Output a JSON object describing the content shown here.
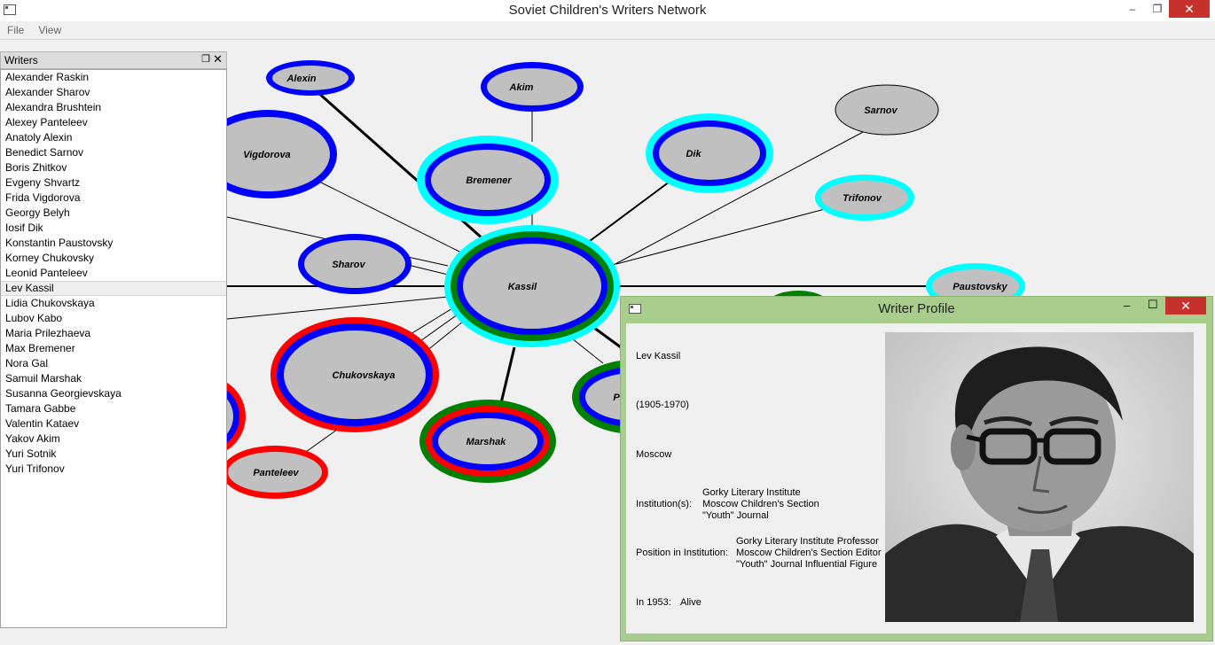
{
  "window": {
    "title": "Soviet Children's Writers Network",
    "min": "–",
    "max": "❐",
    "close": "✕"
  },
  "menu": {
    "file": "File",
    "view": "View"
  },
  "dock": {
    "title": "Writers",
    "float_icon": "❐",
    "close_icon": "✕"
  },
  "writers": [
    "Alexander Raskin",
    "Alexander Sharov",
    "Alexandra Brushtein",
    "Alexey Panteleev",
    "Anatoly Alexin",
    "Benedict Sarnov",
    "Boris Zhitkov",
    "Evgeny Shvartz",
    "Frida Vigdorova",
    "Georgy Belyh",
    "Iosif Dik",
    "Konstantin Paustovsky",
    "Korney Chukovsky",
    "Leonid Panteleev",
    "Lev Kassil",
    "Lidia Chukovskaya",
    "Lubov Kabo",
    "Maria Prilezhaeva",
    "Max Bremener",
    "Nora Gal",
    "Samuil Marshak",
    "Susanna Georgievskaya",
    "Tamara Gabbe",
    "Valentin Kataev",
    "Yakov Akim",
    "Yuri Sotnik",
    "Yuri Trifonov"
  ],
  "selected_writer": "Lev Kassil",
  "colors": {
    "blue": "#0000ff",
    "cyan": "#00ffff",
    "green": "#008000",
    "red": "#ff0000",
    "node_fill": "#c0c0c0"
  },
  "graph": {
    "nodes": [
      {
        "label": "Alexin",
        "rings": [
          "blue"
        ]
      },
      {
        "label": "Akim",
        "rings": [
          "blue"
        ]
      },
      {
        "label": "Sarnov",
        "rings": []
      },
      {
        "label": "Vigdorova",
        "rings": [
          "blue"
        ]
      },
      {
        "label": "Bremener",
        "rings": [
          "cyan",
          "blue"
        ]
      },
      {
        "label": "Dik",
        "rings": [
          "cyan",
          "blue"
        ]
      },
      {
        "label": "Trifonov",
        "rings": [
          "cyan"
        ]
      },
      {
        "label": "Sharov",
        "rings": [
          "blue"
        ]
      },
      {
        "label": "Kassil",
        "rings": [
          "cyan",
          "green",
          "blue"
        ]
      },
      {
        "label": "Paustovsky",
        "rings": [
          "cyan"
        ]
      },
      {
        "label": "Chukovskaya",
        "rings": [
          "red",
          "blue"
        ]
      },
      {
        "label": "Marshak",
        "rings": [
          "green",
          "red",
          "blue"
        ]
      },
      {
        "label": "Panteleev",
        "rings": [
          "red"
        ]
      },
      {
        "label": "P",
        "rings": [
          "green",
          "blue"
        ]
      }
    ]
  },
  "profile": {
    "title": "Writer Profile",
    "min": "–",
    "max": "☐",
    "close": "✕",
    "name": "Lev Kassil",
    "years": "(1905-1970)",
    "city": "Moscow",
    "institutions_label": "Institution(s):",
    "institutions": [
      "Gorky Literary Institute",
      "Moscow Children's Section",
      "\"Youth\" Journal"
    ],
    "positions_label": "Position in Institution:",
    "positions": [
      "Gorky Literary Institute Professor",
      "Moscow Children's Section Editor",
      "\"Youth\" Journal Influential Figure"
    ],
    "status_label": "In 1953:",
    "status": "Alive"
  }
}
